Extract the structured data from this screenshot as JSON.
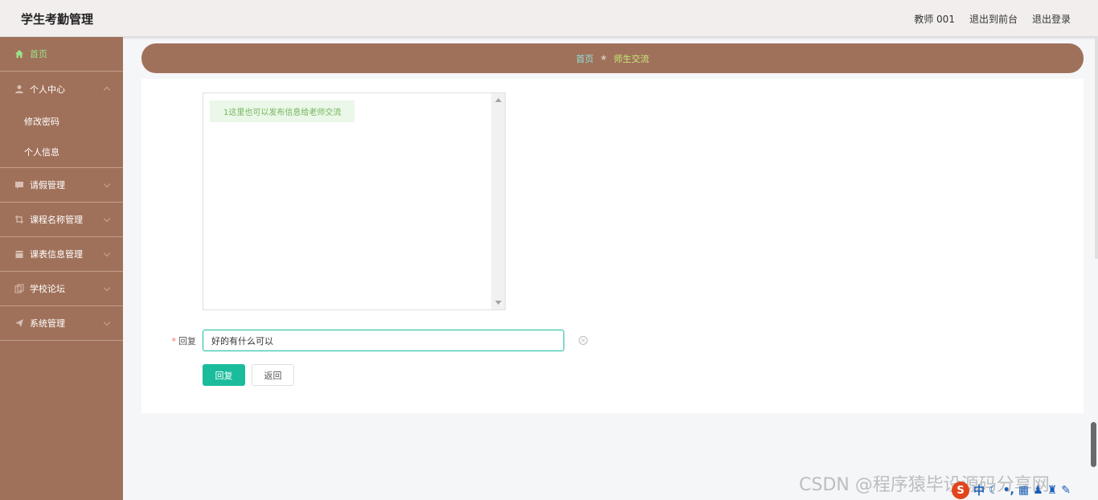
{
  "header": {
    "title": "学生考勤管理",
    "user": "教师 001",
    "front_label": "退出到前台",
    "logout_label": "退出登录"
  },
  "sidebar": {
    "items": [
      {
        "label": "首页",
        "icon": "home-icon",
        "active": true
      },
      {
        "label": "个人中心",
        "icon": "user-icon",
        "expanded": true,
        "children": [
          {
            "label": "修改密码"
          },
          {
            "label": "个人信息"
          }
        ]
      },
      {
        "label": "请假管理",
        "icon": "message-icon"
      },
      {
        "label": "课程名称管理",
        "icon": "crop-icon"
      },
      {
        "label": "课表信息管理",
        "icon": "calendar-icon"
      },
      {
        "label": "学校论坛",
        "icon": "copy-icon"
      },
      {
        "label": "系统管理",
        "icon": "send-icon"
      }
    ]
  },
  "breadcrumb": {
    "home": "首页",
    "separator": "★",
    "current": "师生交流"
  },
  "chat": {
    "messages": [
      {
        "text": "1这里也可以发布信息给老师交流"
      }
    ]
  },
  "form": {
    "reply_label": "回复",
    "required_mark": "*",
    "reply_value": "好的有什么可以",
    "submit_label": "回复",
    "back_label": "返回"
  },
  "overlay": {
    "watermark": "CSDN @程序猿毕设源码分享网",
    "ime_logo": "S",
    "ime_mode": "中"
  },
  "colors": {
    "sidebar_bg": "#a0715a",
    "primary": "#1abc9c",
    "active_menu": "#9be28a"
  }
}
